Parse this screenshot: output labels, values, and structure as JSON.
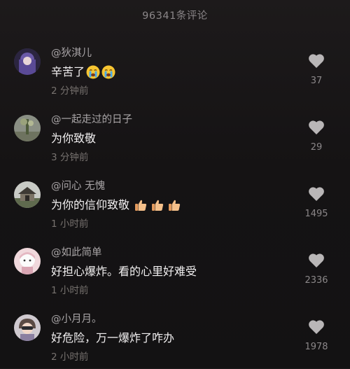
{
  "header": {
    "title": "96341条评论"
  },
  "comments": [
    {
      "user": "@狄淇儿",
      "text": "辛苦了",
      "emojis": [
        "crying-face-icon",
        "crying-face-icon"
      ],
      "time": "2 分钟前",
      "likes": "37"
    },
    {
      "user": "@一起走过的日子",
      "text": "为你致敬",
      "emojis": [],
      "time": "3 分钟前",
      "likes": "29"
    },
    {
      "user": "@问心 无愧",
      "text": "为你的信仰致敬",
      "emojis": [
        "thumbs-up-icon",
        "thumbs-up-icon",
        "thumbs-up-icon"
      ],
      "time": "1 小时前",
      "likes": "1495"
    },
    {
      "user": "@如此简单",
      "text": "好担心爆炸。看的心里好难受",
      "emojis": [],
      "time": "1 小时前",
      "likes": "2336"
    },
    {
      "user": "@小月月。",
      "text": "好危险，万一爆炸了咋办",
      "emojis": [],
      "time": "2 小时前",
      "likes": "1978"
    }
  ],
  "colors": {
    "accent_like": "#b9b6b7",
    "background": "#151314"
  }
}
